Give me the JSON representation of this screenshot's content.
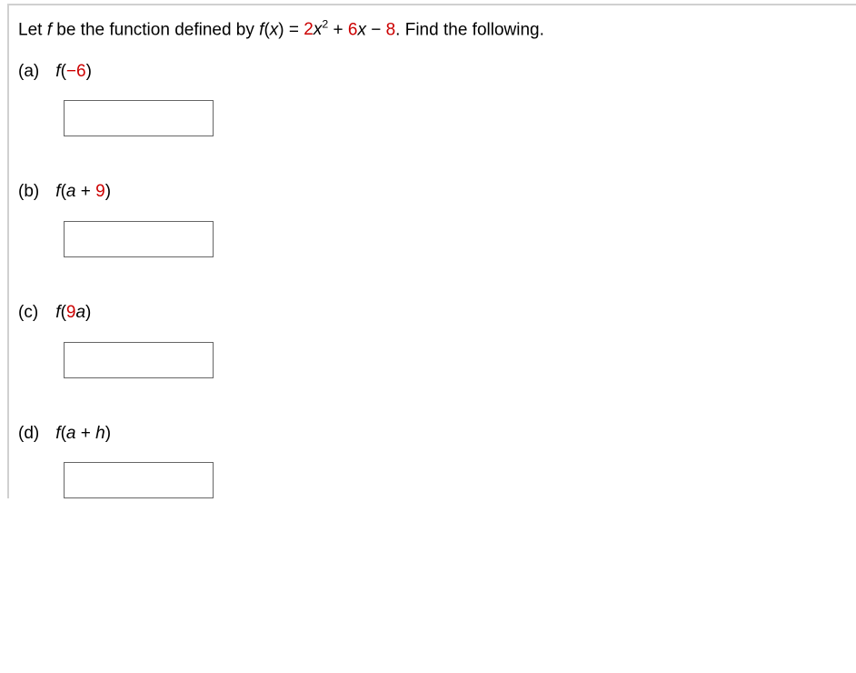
{
  "prompt": {
    "lead": "Let ",
    "f": "f",
    "mid1": " be the function defined by ",
    "fn": "f",
    "open": "(",
    "x1": "x",
    "close": ")",
    "eq": " = ",
    "coef2": "2",
    "x2": "x",
    "exp2": "2",
    "plus": " + ",
    "coef6": "6",
    "x3": "x",
    "minus": " − ",
    "const8": "8",
    "tail": ". Find the following."
  },
  "parts": {
    "a": {
      "marker": "(a)",
      "f": "f",
      "open": "(",
      "neg6": "−6",
      "close": ")",
      "value": ""
    },
    "b": {
      "marker": "(b)",
      "f": "f",
      "open": "(",
      "a": "a",
      "plus": " + ",
      "nine": "9",
      "close": ")",
      "value": ""
    },
    "c": {
      "marker": "(c)",
      "f": "f",
      "open": "(",
      "nine": "9",
      "a": "a",
      "close": ")",
      "value": ""
    },
    "d": {
      "marker": "(d)",
      "f": "f",
      "open": "(",
      "a": "a",
      "plus": " + ",
      "h": "h",
      "close": ")",
      "value": ""
    }
  }
}
